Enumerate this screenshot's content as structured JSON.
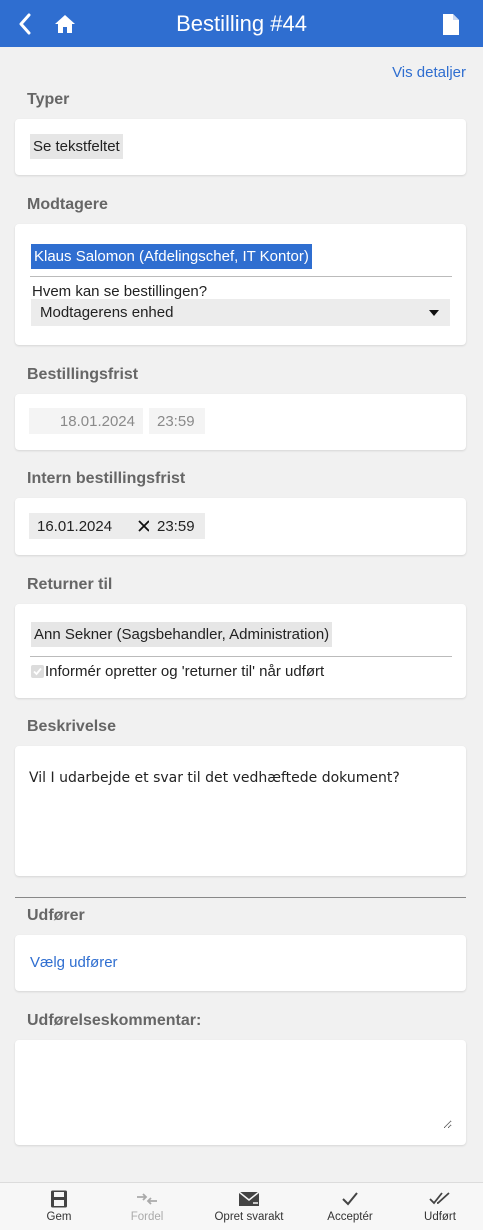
{
  "header": {
    "title": "Bestilling #44",
    "back_icon": "chevron-left-icon",
    "home_icon": "home-icon",
    "document_icon": "document-icon"
  },
  "vis_detaljer": "Vis detaljer",
  "typer": {
    "label": "Typer",
    "chip": "Se tekstfeltet"
  },
  "modtagere": {
    "label": "Modtagere",
    "recipient": "Klaus Salomon (Afdelingschef, IT Kontor)",
    "visibility_question": "Hvem kan se bestillingen?",
    "visibility_value": "Modtagerens enhed"
  },
  "bestillingsfrist": {
    "label": "Bestillingsfrist",
    "date": "18.01.2024",
    "time": "23:59"
  },
  "intern_frist": {
    "label": "Intern bestillingsfrist",
    "date": "16.01.2024",
    "time": "23:59",
    "clear_icon": "close-icon"
  },
  "returner_til": {
    "label": "Returner til",
    "person": "Ann Sekner (Sagsbehandler, Administration)",
    "notify_label": "Informér opretter og 'returner til' når udført",
    "notify_checked": true
  },
  "beskrivelse": {
    "label": "Beskrivelse",
    "text": "Vil I udarbejde et svar til det vedhæftede dokument?"
  },
  "udforer": {
    "label": "Udfører",
    "link": "Vælg udfører"
  },
  "kommentar": {
    "label": "Udførelseskommentar:",
    "value": ""
  },
  "toolbar": {
    "items": [
      {
        "label": "Gem",
        "icon": "save-icon"
      },
      {
        "label": "Fordel",
        "icon": "distribute-icon"
      },
      {
        "label": "Opret svarakt",
        "icon": "reply-mail-icon"
      },
      {
        "label": "Acceptér",
        "icon": "check-icon"
      },
      {
        "label": "Udført",
        "icon": "double-check-icon"
      }
    ]
  },
  "colors": {
    "primary": "#2f6ed0",
    "background": "#f1f1f1"
  }
}
